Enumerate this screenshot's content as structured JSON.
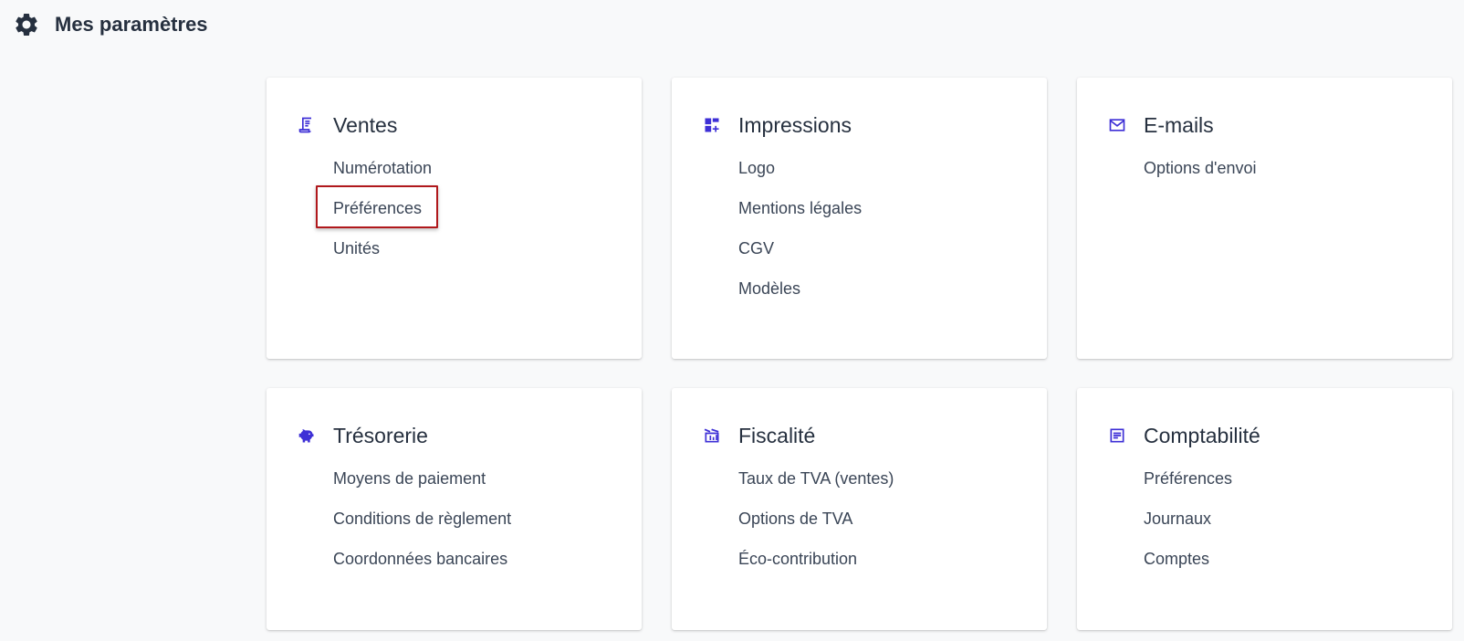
{
  "header": {
    "title": "Mes paramètres",
    "icon": "gear-icon"
  },
  "colors": {
    "accent": "#3d2fd6",
    "highlight": "#b0181c",
    "text": "#26303f"
  },
  "cards": [
    {
      "title": "Ventes",
      "icon": "receipt-icon",
      "links": [
        "Numérotation",
        "Préférences",
        "Unités"
      ]
    },
    {
      "title": "Impressions",
      "icon": "dashboard-add-icon",
      "links": [
        "Logo",
        "Mentions légales",
        "CGV",
        "Modèles"
      ]
    },
    {
      "title": "E-mails",
      "icon": "mail-icon",
      "links": [
        "Options d'envoi"
      ]
    },
    {
      "title": "Trésorerie",
      "icon": "piggy-bank-icon",
      "links": [
        "Moyens de paiement",
        "Conditions de règlement",
        "Coordonnées bancaires"
      ]
    },
    {
      "title": "Fiscalité",
      "icon": "tax-icon",
      "links": [
        "Taux de TVA (ventes)",
        "Options de TVA",
        "Éco-contribution"
      ]
    },
    {
      "title": "Comptabilité",
      "icon": "ledger-icon",
      "links": [
        "Préférences",
        "Journaux",
        "Comptes"
      ]
    }
  ]
}
